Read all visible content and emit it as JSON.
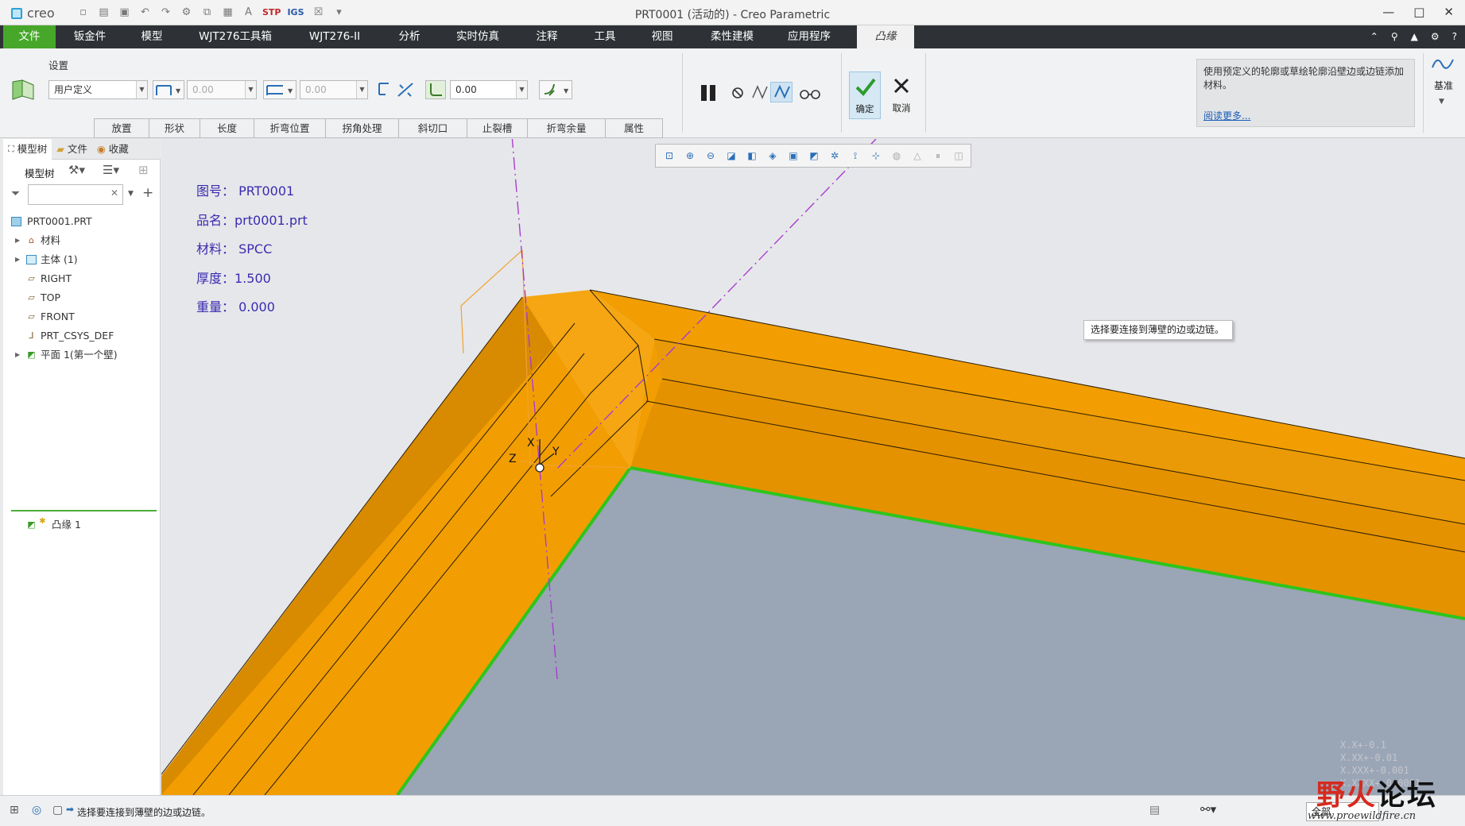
{
  "app": {
    "logo": "creo",
    "window_title": "PRT0001 (活动的) - Creo Parametric"
  },
  "tabs": [
    {
      "label": "文件"
    },
    {
      "label": "钣金件"
    },
    {
      "label": "模型"
    },
    {
      "label": "WJT276工具箱"
    },
    {
      "label": "WJT276-II"
    },
    {
      "label": "分析"
    },
    {
      "label": "实时仿真"
    },
    {
      "label": "注释"
    },
    {
      "label": "工具"
    },
    {
      "label": "视图"
    },
    {
      "label": "柔性建模"
    },
    {
      "label": "应用程序"
    },
    {
      "label": "凸缘"
    }
  ],
  "ribbon": {
    "group_label": "设置",
    "shape_combo": "用户定义",
    "length1": "0.00",
    "length2": "0.00",
    "bend_radius": "0.00",
    "subtabs": [
      "放置",
      "形状",
      "长度",
      "折弯位置",
      "拐角处理",
      "斜切口",
      "止裂槽",
      "折弯余量",
      "属性"
    ],
    "ok_label": "确定",
    "cancel_label": "取消",
    "help_text": "使用预定义的轮廓或草绘轮廓沿壁边或边链添加材料。",
    "help_link": "阅读更多...",
    "datum_label": "基准"
  },
  "left_panel": {
    "tabs": [
      "模型树",
      "文件",
      "收藏"
    ],
    "tree_label": "模型树",
    "items": [
      {
        "label": "PRT0001.PRT"
      },
      {
        "label": "材料"
      },
      {
        "label": "主体 (1)"
      },
      {
        "label": "RIGHT"
      },
      {
        "label": "TOP"
      },
      {
        "label": "FRONT"
      },
      {
        "label": "PRT_CSYS_DEF"
      },
      {
        "label": "平面 1(第一个壁)"
      },
      {
        "label": "凸缘 1"
      }
    ]
  },
  "viewport": {
    "annotations": [
      "图号： PRT0001",
      "品名：prt0001.prt",
      "材料：  SPCC",
      "厚度：1.500",
      "重量：  0.000"
    ],
    "tooltip": "选择要连接到薄壁的边或边链。",
    "axis_x": "X",
    "axis_y": "Y",
    "axis_z": "Z",
    "tolerance_lines": [
      "X.X+-0.1",
      "X.XX+-0.01",
      "X.XXX+-0.001",
      "X.XXXX+-0.0001"
    ],
    "colors": {
      "part": "#f29e02",
      "floor": "#9aa5b6",
      "edge_highlight": "#2ec51c",
      "datum": "#a83cd2"
    }
  },
  "status": {
    "message": "选择要连接到薄壁的边或边链。",
    "filter": "全部"
  },
  "watermark": {
    "text1": "野火",
    "text2": "论坛",
    "url": "www.proewildfire.cn"
  }
}
